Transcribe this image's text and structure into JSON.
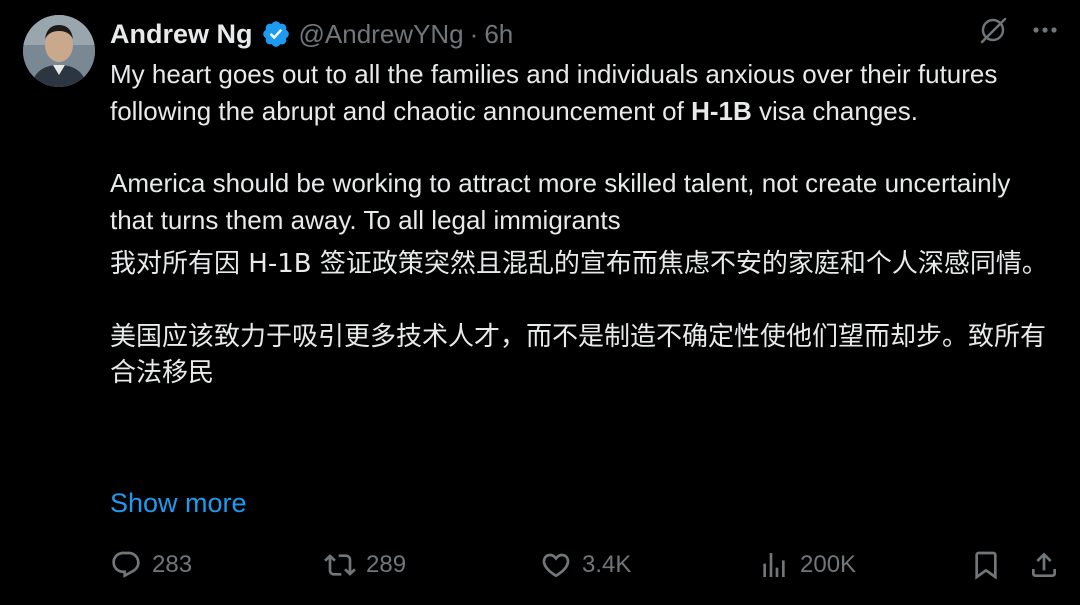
{
  "author": {
    "display_name": "Andrew Ng",
    "handle": "@AndrewYNg",
    "separator": "·",
    "time": "6h",
    "verified": true
  },
  "colors": {
    "background": "#000000",
    "text": "#e7e9ea",
    "muted": "#71767b",
    "accent": "#1d9bf0"
  },
  "tweet": {
    "en_paragraph_1_before": "My heart goes out to all the families and individuals anxious over their futures following the abrupt and chaotic announcement of ",
    "en_paragraph_1_bold": "H-1B",
    "en_paragraph_1_after": " visa changes.",
    "en_paragraph_2": "America should be working to attract more skilled talent, not create uncertainly that turns them away. To all legal immigrants",
    "zh_paragraph_1": "我对所有因 H-1B 签证政策突然且混乱的宣布而焦虑不安的家庭和个人深感同情。",
    "zh_paragraph_2": "美国应该致力于吸引更多技术人才，而不是制造不确定性使他们望而却步。致所有合法移民",
    "show_more": "Show more"
  },
  "actions": {
    "replies": "283",
    "reposts": "289",
    "likes": "3.4K",
    "views": "200K"
  },
  "icons": [
    "verified-badge-icon",
    "grok-icon",
    "more-icon",
    "reply-icon",
    "repost-icon",
    "like-icon",
    "views-icon",
    "bookmark-icon",
    "share-icon"
  ]
}
